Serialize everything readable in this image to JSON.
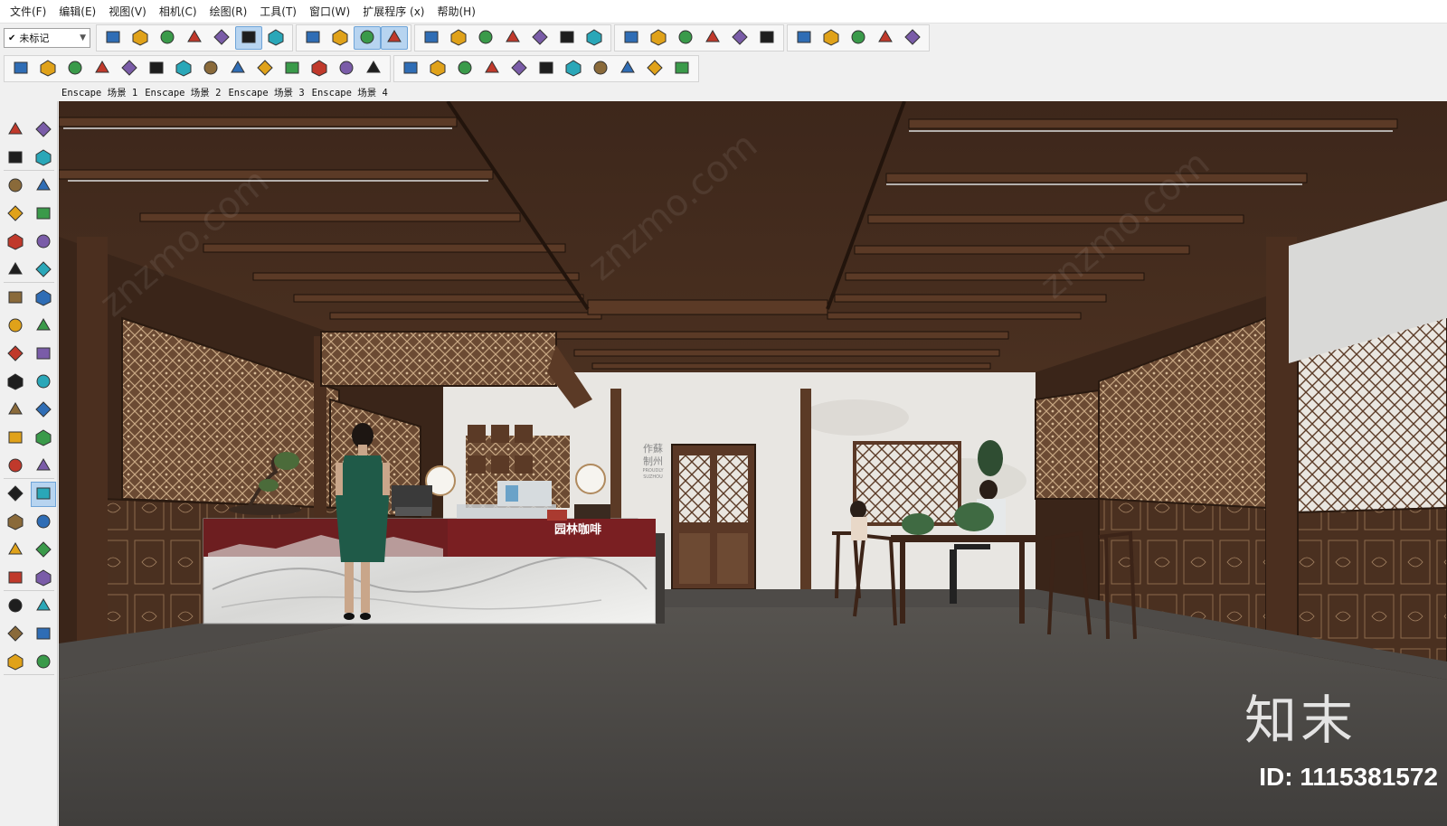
{
  "menu": {
    "items": [
      {
        "label": "文件(F)"
      },
      {
        "label": "编辑(E)"
      },
      {
        "label": "视图(V)"
      },
      {
        "label": "相机(C)"
      },
      {
        "label": "绘图(R)"
      },
      {
        "label": "工具(T)"
      },
      {
        "label": "窗口(W)"
      },
      {
        "label": "扩展程序 (x)"
      },
      {
        "label": "帮助(H)"
      }
    ]
  },
  "toolbar": {
    "tag_select_value": "未标记"
  },
  "scene_tabs": [
    {
      "label": "Enscape 场景 1"
    },
    {
      "label": "Enscape 场景 2"
    },
    {
      "label": "Enscape 场景 3"
    },
    {
      "label": "Enscape 场景 4"
    }
  ],
  "scene": {
    "counter_sign": "园林咖啡",
    "wall_sign_line1": "作蘇",
    "wall_sign_line2": "制州",
    "wall_sign_small": "PROUDLY SUZHOU"
  },
  "watermark": {
    "logo": "知末",
    "id": "ID: 1115381572"
  },
  "colors": {
    "accent_active": "#b7d4f0",
    "ceiling": "#3b2519",
    "floor": "#4a4848",
    "wall": "#e8e6e2",
    "screen_wood": "#5a3a26"
  },
  "icons": {
    "toolbar1": [
      "paint-bucket-icon",
      "component-icon",
      "cube-icon",
      "box-icon",
      "box-dark-icon",
      "layers-icon",
      "box-blue-icon",
      "orbit-icon",
      "section-icon",
      "iso-view-icon",
      "iso-view2-icon",
      "camera-icon",
      "camera-orb-icon",
      "walk-icon",
      "look-icon",
      "plane-icon",
      "plane-fold-icon",
      "no-entry-icon",
      "house-3d-icon",
      "book-icon",
      "house-icon",
      "house-box-icon",
      "house-outline-icon",
      "house-front-icon",
      "select-arrow-icon",
      "paint-icon",
      "move-icon",
      "dimension-icon",
      "person-icon"
    ],
    "toolbar2": [
      "shield-icon",
      "refresh-icon",
      "car-icon",
      "projector-icon",
      "image-icon",
      "film-icon",
      "settings-shield-icon",
      "tree-icon",
      "target-icon",
      "speaker-icon",
      "sliders-icon",
      "sliders2-icon",
      "chat-icon",
      "info-icon",
      "doc-a-icon",
      "doc-b-icon",
      "doc-c-icon",
      "doc-d-icon",
      "list-a-icon",
      "list-b-icon",
      "list-c-icon",
      "list-d-icon",
      "window-a-icon",
      "window-b-icon",
      "globe-icon"
    ],
    "palette": [
      "select-icon",
      "component-outline-icon",
      "paint-bucket-icon",
      "eraser-icon",
      "pencil-icon",
      "freehand-icon",
      "rectangle-icon",
      "rotated-rect-icon",
      "circle-icon",
      "polygon-icon",
      "arc-icon",
      "arc2-icon",
      "pie-icon",
      "arc3-icon",
      "move-icon",
      "pushpull-icon",
      "rotate-icon",
      "followme-icon",
      "scale-icon",
      "offset-icon",
      "tape-icon",
      "protractor-icon",
      "axes-icon",
      "text-icon",
      "3d-text-icon",
      "dimension-icon",
      "orbit-icon",
      "pan-icon",
      "zoom-icon",
      "zoom-window-icon",
      "zoom-extents-icon",
      "previous-icon",
      "position-camera-icon",
      "lookaround-icon",
      "walk-icon",
      "section-plane-icon",
      "warehouse-icon",
      "extension-icon",
      "ruby-icon",
      "gem-icon"
    ]
  }
}
